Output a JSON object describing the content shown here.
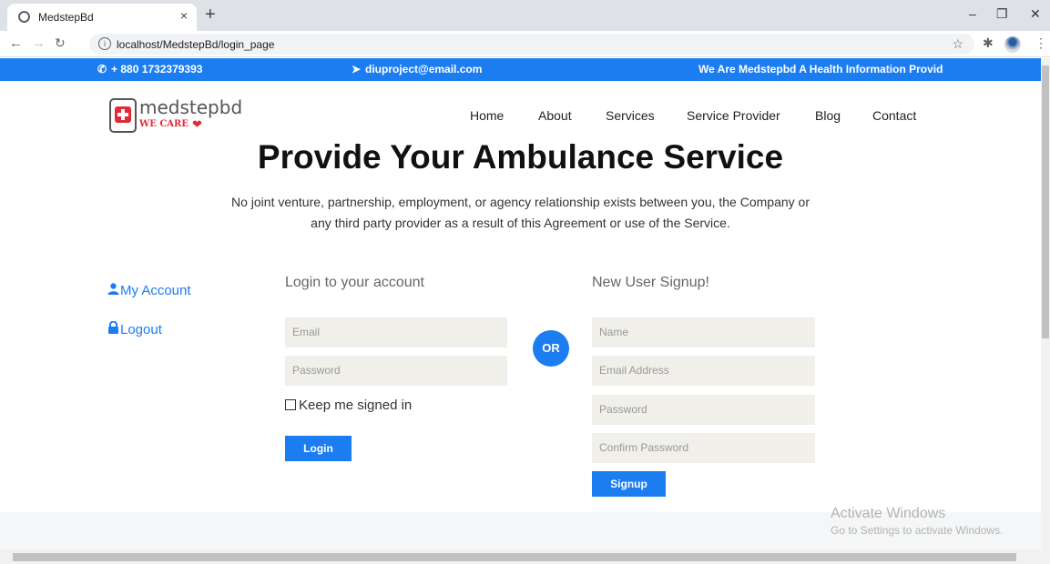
{
  "browser": {
    "tab_title": "MedstepBd",
    "tab_close": "×",
    "new_tab": "+",
    "url": "localhost/MedstepBd/login_page",
    "minimize": "–",
    "restore": "❐",
    "close": "✕"
  },
  "topbar": {
    "phone": "+ 880 1732379393",
    "email": "diuproject@email.com",
    "tagline": "We Are Medstepbd A Health Information Provid",
    "color": "#1c7df0"
  },
  "logo": {
    "name": "medstepbd",
    "tagline": "WE CARE"
  },
  "nav": {
    "home": "Home",
    "about": "About",
    "services": "Services",
    "service_provider": "Service Provider",
    "blog": "Blog",
    "contact": "Contact"
  },
  "hero": {
    "title": "Provide Your Ambulance Service",
    "line1": "No joint venture, partnership, employment, or agency relationship exists between you, the Company or",
    "line2": "any third party provider as a result of this Agreement or use of the Service."
  },
  "sidebar": {
    "my_account": "My Account",
    "logout": "Logout"
  },
  "login": {
    "title": "Login to your account",
    "email_placeholder": "Email",
    "password_placeholder": "Password",
    "keep_signed_in": "Keep me signed in",
    "button": "Login"
  },
  "divider": "OR",
  "signup": {
    "title": "New User Signup!",
    "name_placeholder": "Name",
    "email_placeholder": "Email Address",
    "password_placeholder": "Password",
    "confirm_placeholder": "Confirm Password",
    "button": "Signup"
  },
  "watermark": {
    "line1": "Activate Windows",
    "line2": "Go to Settings to activate Windows."
  }
}
